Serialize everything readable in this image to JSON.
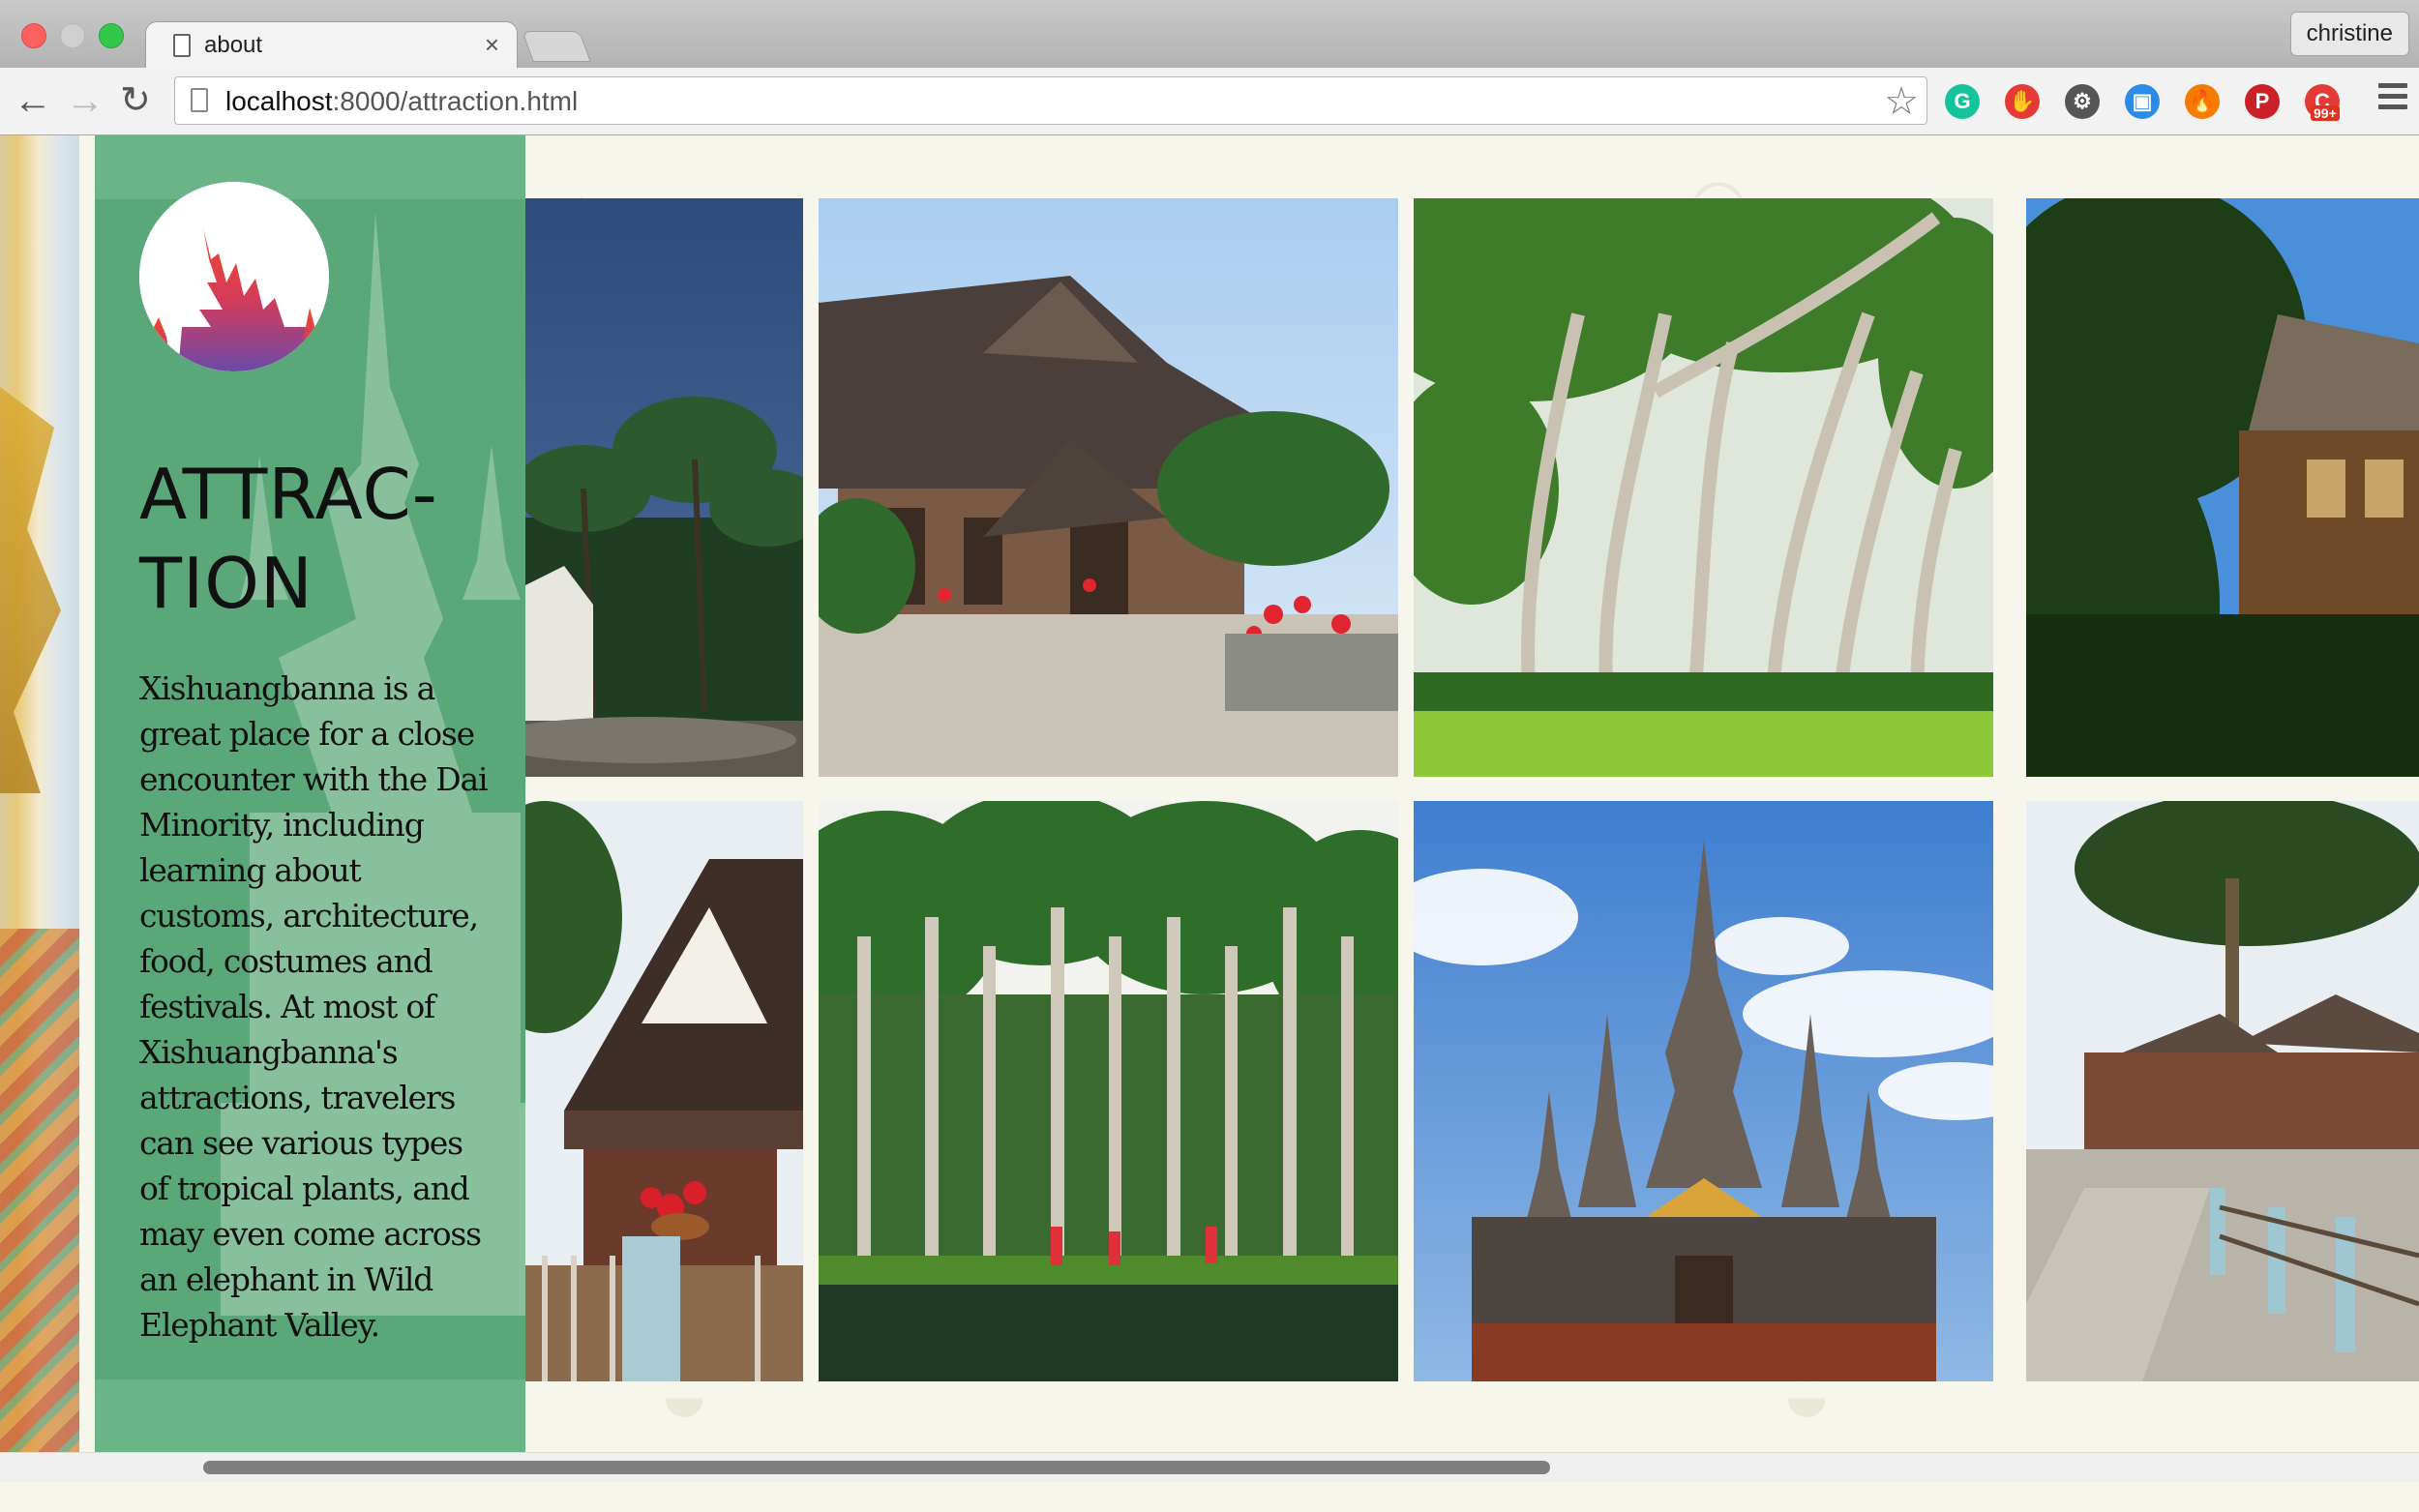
{
  "browser": {
    "tab_title": "about",
    "tab_close": "×",
    "profile_name": "christine",
    "url_host": "localhost",
    "url_path": ":8000/attraction.html",
    "back_icon": "back-arrow-icon",
    "forward_icon": "forward-arrow-icon",
    "reload_icon": "reload-icon",
    "extensions": [
      {
        "name": "grammarly-extension-icon",
        "color": "#15c39a",
        "glyph": "G"
      },
      {
        "name": "adblock-extension-icon",
        "color": "#e53935",
        "glyph": "✋"
      },
      {
        "name": "puzzle-extension-icon",
        "color": "#555555",
        "glyph": "⚙"
      },
      {
        "name": "window-extension-icon",
        "color": "#2b8ce8",
        "glyph": "▣"
      },
      {
        "name": "fire-extension-icon",
        "color": "#f57c00",
        "glyph": "🔥"
      },
      {
        "name": "pinterest-extension-icon",
        "color": "#cb2027",
        "glyph": "P"
      },
      {
        "name": "notifier-extension-icon",
        "color": "#e53935",
        "glyph": "C",
        "badge": "99+"
      }
    ]
  },
  "sidebar": {
    "title_line1": "ATTRAC-",
    "title_line2": "TION",
    "description": "Xishuangbanna is a great place for a close encounter with the Dai Minority, including learning about customs, architecture, food, costumes and festivals. At most of Xishuangbanna's attractions, travelers can see various types of tropical plants, and may even come across an elephant in Wild Elephant Valley."
  },
  "gallery": {
    "photos": [
      "stupa-palms-photo",
      "dai-house-photo",
      "banyan-tree-photo",
      "wooden-house-tree-photo",
      "dai-roof-flowers-photo",
      "palm-avenue-pond-photo",
      "golden-pagoda-photo",
      "village-lane-photo"
    ]
  }
}
